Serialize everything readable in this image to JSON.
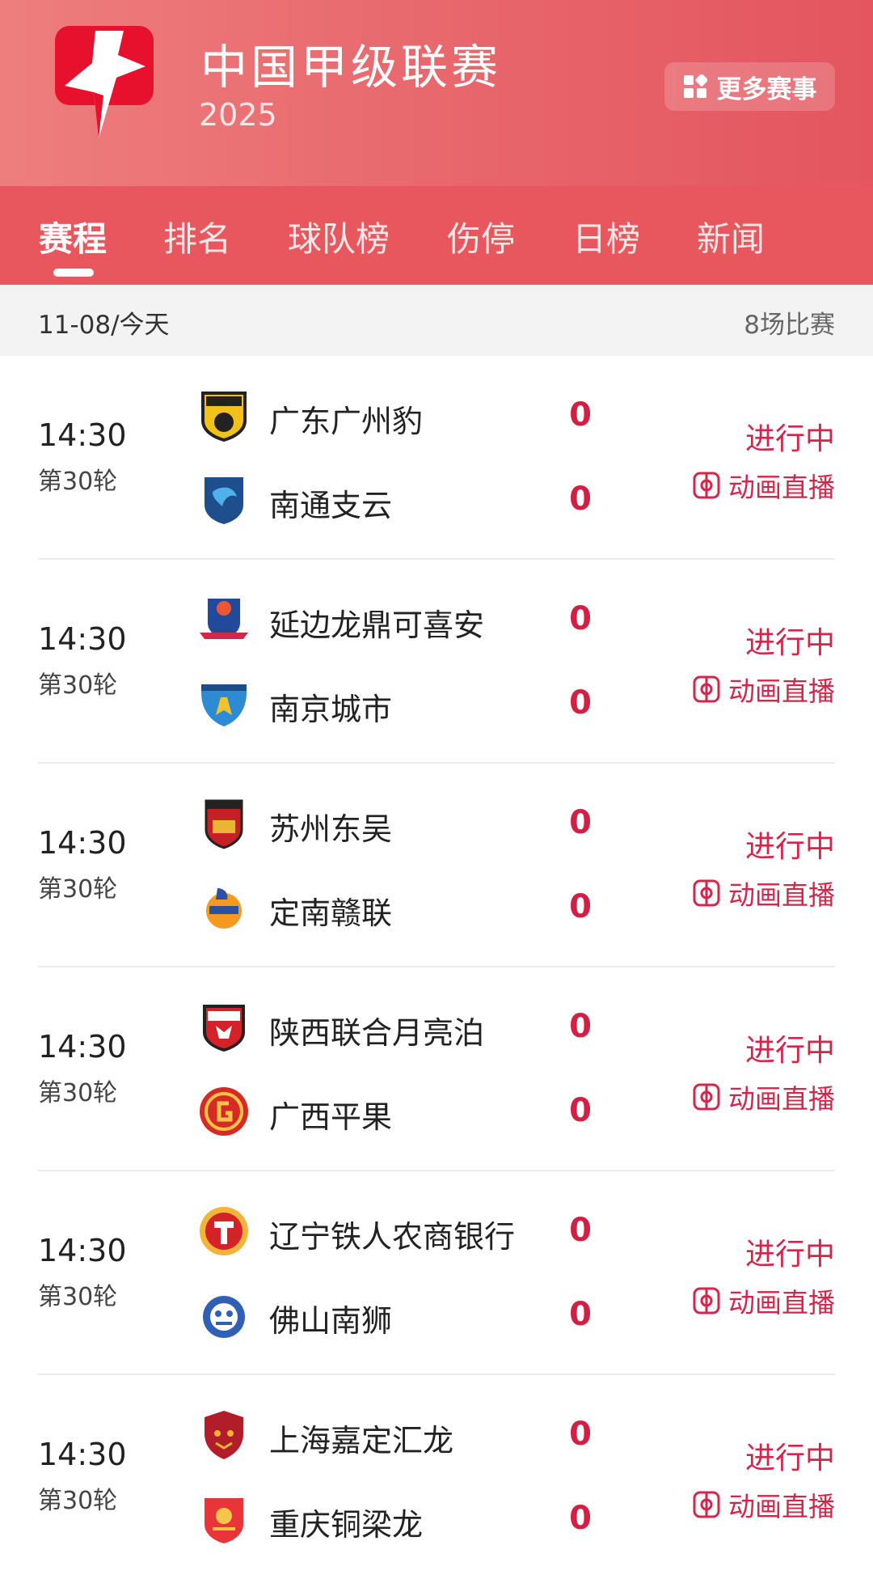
{
  "header": {
    "title": "中国甲级联赛",
    "year": "2025",
    "more_button_label": "更多赛事",
    "brand_color": "#e8575d",
    "logo_icon": "competition-logo"
  },
  "tabs": [
    {
      "label": "赛程",
      "active": true
    },
    {
      "label": "排名"
    },
    {
      "label": "球队榜"
    },
    {
      "label": "伤停"
    },
    {
      "label": "日榜"
    },
    {
      "label": "新闻"
    }
  ],
  "date_bar": {
    "date": "11-08/今天",
    "count": "8场比赛"
  },
  "matches": [
    {
      "time": "14:30",
      "round": "第30轮",
      "home": {
        "name": "广东广州豹",
        "score": "0"
      },
      "away": {
        "name": "南通支云",
        "score": "0"
      },
      "status": "进行中",
      "live": "动画直播"
    },
    {
      "time": "14:30",
      "round": "第30轮",
      "home": {
        "name": "延边龙鼎可喜安",
        "score": "0"
      },
      "away": {
        "name": "南京城市",
        "score": "0"
      },
      "status": "进行中",
      "live": "动画直播"
    },
    {
      "time": "14:30",
      "round": "第30轮",
      "home": {
        "name": "苏州东吴",
        "score": "0"
      },
      "away": {
        "name": "定南赣联",
        "score": "0"
      },
      "status": "进行中",
      "live": "动画直播"
    },
    {
      "time": "14:30",
      "round": "第30轮",
      "home": {
        "name": "陕西联合月亮泊",
        "score": "0"
      },
      "away": {
        "name": "广西平果",
        "score": "0"
      },
      "status": "进行中",
      "live": "动画直播"
    },
    {
      "time": "14:30",
      "round": "第30轮",
      "home": {
        "name": "辽宁铁人农商银行",
        "score": "0"
      },
      "away": {
        "name": "佛山南狮",
        "score": "0"
      },
      "status": "进行中",
      "live": "动画直播"
    },
    {
      "time": "14:30",
      "round": "第30轮",
      "home": {
        "name": "上海嘉定汇龙",
        "score": "0"
      },
      "away": {
        "name": "重庆铜梁龙",
        "score": "0"
      },
      "status": "进行中",
      "live": "动画直播"
    }
  ],
  "colors": {
    "score": "#d31f44",
    "status": "#d3264b"
  }
}
